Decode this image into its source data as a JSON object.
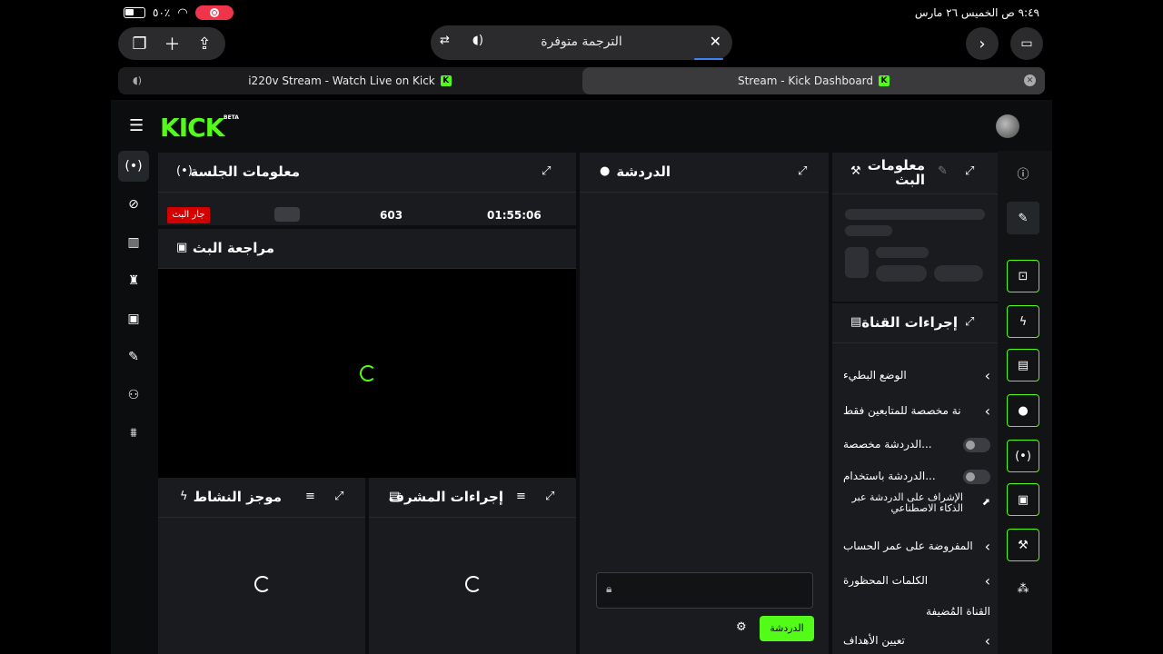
{
  "status_bar": {
    "time_date": "٩:٤٩ ص   الخميس ٢٦ مارس",
    "battery_percent": "٥٠٪"
  },
  "browser": {
    "url_text": "الترجمة متوفرة",
    "tabs": [
      {
        "label": "i220v Stream - Watch Live on Kick",
        "active": false
      },
      {
        "label": "Stream - Kick Dashboard",
        "active": true
      }
    ]
  },
  "header": {
    "logo": "KICK",
    "logo_badge": "BETA"
  },
  "session": {
    "title": "معلومات الجلسة",
    "live_badge": "جار البث",
    "viewers": "603",
    "duration": "01:55:06"
  },
  "preview": {
    "title": "مراجعة البث"
  },
  "chat": {
    "title": "الدردشة",
    "send_label": "الدردشة"
  },
  "stream_info": {
    "title": "معلومات البث"
  },
  "channel_actions": {
    "title": "إجراءات القناة",
    "items": [
      {
        "label": "الوضع البطيء",
        "control": "chevron"
      },
      {
        "label": "نة مخصصة للمتابعين فقط",
        "control": "chevron"
      },
      {
        "label": "...الدردشة مخصصة",
        "control": "toggle"
      },
      {
        "label": "...الدردشة باستخدام",
        "control": "toggle"
      },
      {
        "label": "الإشراف على الدردشة عبر الذكاء الاصطناعي",
        "control": "external"
      },
      {
        "label": "المفروضة على عمر الحساب",
        "control": "chevron"
      },
      {
        "label": "الكلمات المحظورة",
        "control": "chevron"
      },
      {
        "label": "القناة المُضيفة",
        "control": "none"
      },
      {
        "label": "تعيين الأهداف",
        "control": "chevron"
      }
    ]
  },
  "activity": {
    "title": "موجز النشاط"
  },
  "mod_actions": {
    "title": "إجراءات المشرف"
  },
  "colors": {
    "brand": "#53fc18",
    "panel": "#191b1f",
    "live": "#d40000"
  }
}
